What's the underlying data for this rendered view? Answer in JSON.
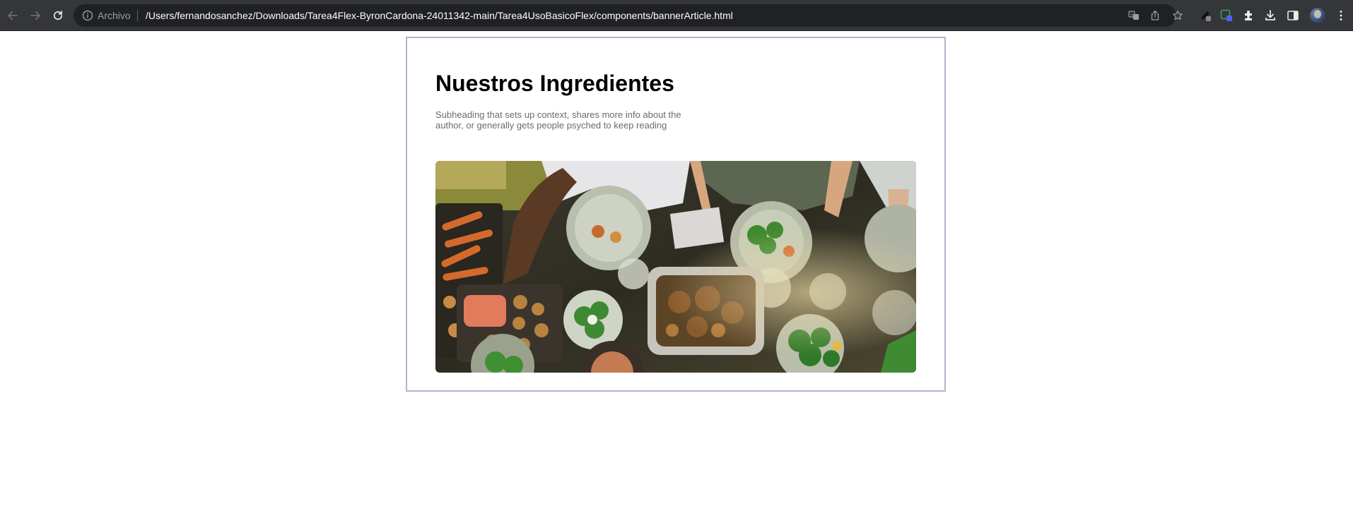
{
  "browser": {
    "back_icon": "arrow-left-icon",
    "forward_icon": "arrow-right-icon",
    "reload_icon": "reload-icon",
    "site_info_icon": "info-icon",
    "site_label": "Archivo",
    "url": "/Users/fernandosanchez/Downloads/Tarea4Flex-ByronCardona-24011342-main/Tarea4UsoBasicoFlex/components/bannerArticle.html",
    "omnibox_icons": [
      "translate-icon",
      "share-icon",
      "bookmark-star-icon"
    ],
    "toolbar_icons": [
      "pen-extension-icon",
      "screen-capture-extension-icon",
      "extensions-puzzle-icon",
      "download-icon",
      "side-panel-icon",
      "profile-avatar",
      "more-vertical-icon"
    ],
    "colors": {
      "chrome_bg": "#35363a",
      "omnibox_bg": "#202124",
      "url_text": "#ffffff"
    }
  },
  "article": {
    "title": "Nuestros Ingredientes",
    "subtitle": "Subheading that sets up context, shares more info about the author, or generally gets people psyched to keep reading",
    "image_alt": "Overhead view of people sharing a table of roasted vegetables, salads and wine",
    "colors": {
      "border": "#b3b3c9",
      "title": "#000000",
      "subtitle": "#6b6b6b"
    }
  }
}
